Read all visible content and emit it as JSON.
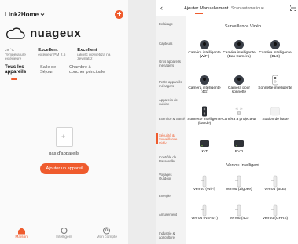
{
  "left": {
    "home_title": "Link2Home",
    "weather": "nuageux",
    "stats": [
      {
        "value": "29 °C",
        "label": "Température extérieure"
      },
      {
        "value": "Excellent",
        "label": "extérieur PM 2.5"
      },
      {
        "value": "Excellent",
        "label": "jakość powietrza na zewnątrz"
      }
    ],
    "rooms": [
      "Tous les appareils",
      "Salle de Séjour",
      "Chambre à coucher principale"
    ],
    "empty_text": "pas d'appareils",
    "add_button": "Ajouter un appareil",
    "nav": [
      "Maison",
      "Intelligent",
      "Mon compte"
    ]
  },
  "right": {
    "tab_manual": "Ajouter Manuellement",
    "tab_scan": "Scan automatique",
    "categories": [
      "Éclairage",
      "Capteurs",
      "Gros appareils ménagers",
      "Petits appareils ménagers",
      "Appareils de cuisine",
      "Exercice & Santé",
      "Sécurité & Surveillance Vidéo",
      "Contrôle de Passerelle",
      "Voyages Outdoor",
      "Énergie",
      "Amusement",
      "Industrie & agriculture"
    ],
    "section_video": "Surveillance Vidéo",
    "section_lock": "Verrou Intelligent",
    "video_devices": [
      "Caméra intelligente (WiFi)",
      "Caméra intelligente (Bas Caméra)",
      "Caméra intelligente (BLE)",
      "Caméra intelligente (4G)",
      "Caméra pour sonnette",
      "Sonnette intelligente",
      "Sonnette intelligente (bande)",
      "Caméra à projecteur",
      "Station de base",
      "NVR",
      "DVR"
    ],
    "lock_devices": [
      "Verrou (WiFi)",
      "Verrou (Zigbee)",
      "Verrou (BLE)",
      "Verrou (NB-IoT)",
      "Verrou (4G)",
      "Verrou (GPRS)"
    ]
  },
  "colors": {
    "accent": "#ef5b2d"
  }
}
